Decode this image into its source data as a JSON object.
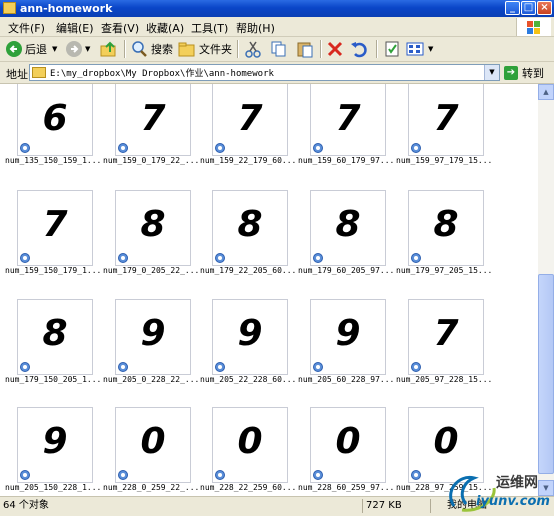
{
  "window": {
    "title": "ann-homework"
  },
  "menu": {
    "items": [
      "文件(F)",
      "编辑(E)",
      "查看(V)",
      "收藏(A)",
      "工具(T)",
      "帮助(H)"
    ]
  },
  "toolbar": {
    "back_label": "后退",
    "search_label": "搜索",
    "folders_label": "文件夹"
  },
  "address": {
    "label": "地址(D)",
    "value": "E:\\my_dropbox\\My Dropbox\\作业\\ann-homework",
    "go_label": "转到"
  },
  "files": [
    {
      "name": "num_135_150_159_1...",
      "digit": "6"
    },
    {
      "name": "num_159_0_179_22_...",
      "digit": "7"
    },
    {
      "name": "num_159_22_179_60...",
      "digit": "7"
    },
    {
      "name": "num_159_60_179_97...",
      "digit": "7"
    },
    {
      "name": "num_159_97_179_15...",
      "digit": "7"
    },
    {
      "name": "num_159_150_179_1...",
      "digit": "7"
    },
    {
      "name": "num_179_0_205_22_...",
      "digit": "8"
    },
    {
      "name": "num_179_22_205_60...",
      "digit": "8"
    },
    {
      "name": "num_179_60_205_97...",
      "digit": "8"
    },
    {
      "name": "num_179_97_205_15...",
      "digit": "8"
    },
    {
      "name": "num_179_150_205_1...",
      "digit": "8"
    },
    {
      "name": "num_205_0_228_22_...",
      "digit": "9"
    },
    {
      "name": "num_205_22_228_60...",
      "digit": "9"
    },
    {
      "name": "num_205_60_228_97...",
      "digit": "9"
    },
    {
      "name": "num_205_97_228_15...",
      "digit": "7"
    },
    {
      "name": "num_205_150_228_1...",
      "digit": "9"
    },
    {
      "name": "num_228_0_259_22_...",
      "digit": "0"
    },
    {
      "name": "num_228_22_259_60...",
      "digit": "0"
    },
    {
      "name": "num_228_60_259_97...",
      "digit": "0"
    },
    {
      "name": "num_228_97_259_15...",
      "digit": "0"
    }
  ],
  "status": {
    "count": "64 个对象",
    "size": "727 KB",
    "location": "我的电脑"
  },
  "watermark": {
    "text1": "运维网",
    "text2": "iyunv.com"
  }
}
